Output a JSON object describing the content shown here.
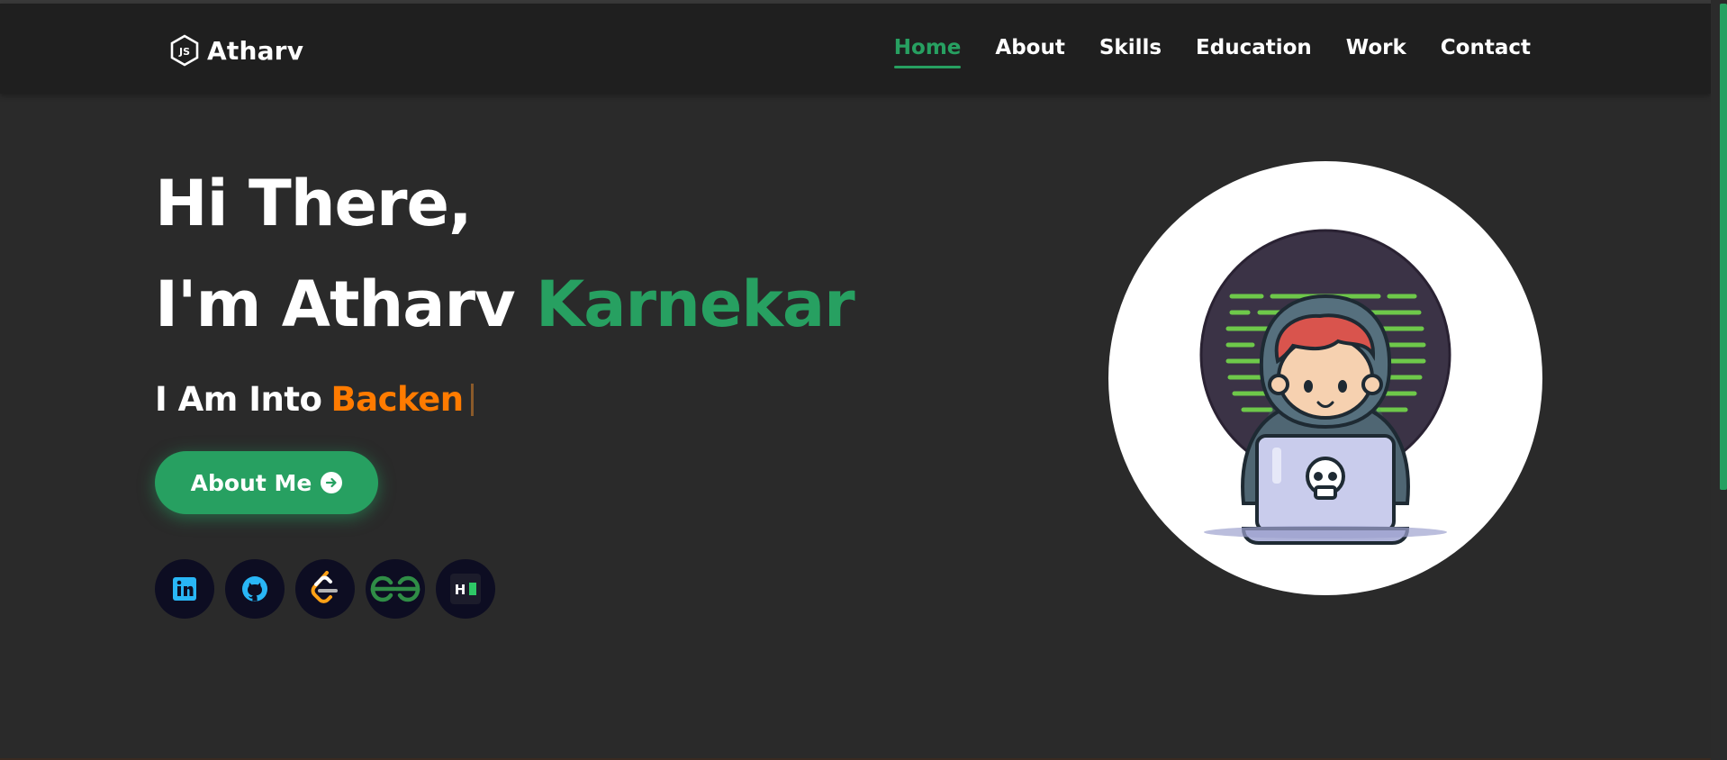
{
  "brand": {
    "name": "Atharv",
    "icon": "js-hexagon-icon"
  },
  "nav": {
    "items": [
      {
        "label": "Home",
        "active": true
      },
      {
        "label": "About",
        "active": false
      },
      {
        "label": "Skills",
        "active": false
      },
      {
        "label": "Education",
        "active": false
      },
      {
        "label": "Work",
        "active": false
      },
      {
        "label": "Contact",
        "active": false
      }
    ]
  },
  "hero": {
    "greeting": "Hi There,",
    "intro_prefix": "I'm Atharv",
    "intro_accent": "Karnekar",
    "into_prefix": "I Am Into",
    "typed_text": "Backen",
    "button_label": "About Me"
  },
  "socials": [
    {
      "name": "linkedin",
      "icon": "linkedin-icon"
    },
    {
      "name": "github",
      "icon": "github-icon"
    },
    {
      "name": "leetcode",
      "icon": "leetcode-icon"
    },
    {
      "name": "geeksforgeeks",
      "icon": "geeksforgeeks-icon"
    },
    {
      "name": "hackerrank",
      "icon": "hackerrank-icon"
    }
  ],
  "colors": {
    "accent": "#27a061",
    "typed": "#ff7b00",
    "background": "#2a2a2a",
    "navbar": "#1f1f1f"
  },
  "illustration": "hacker-with-laptop-avatar"
}
